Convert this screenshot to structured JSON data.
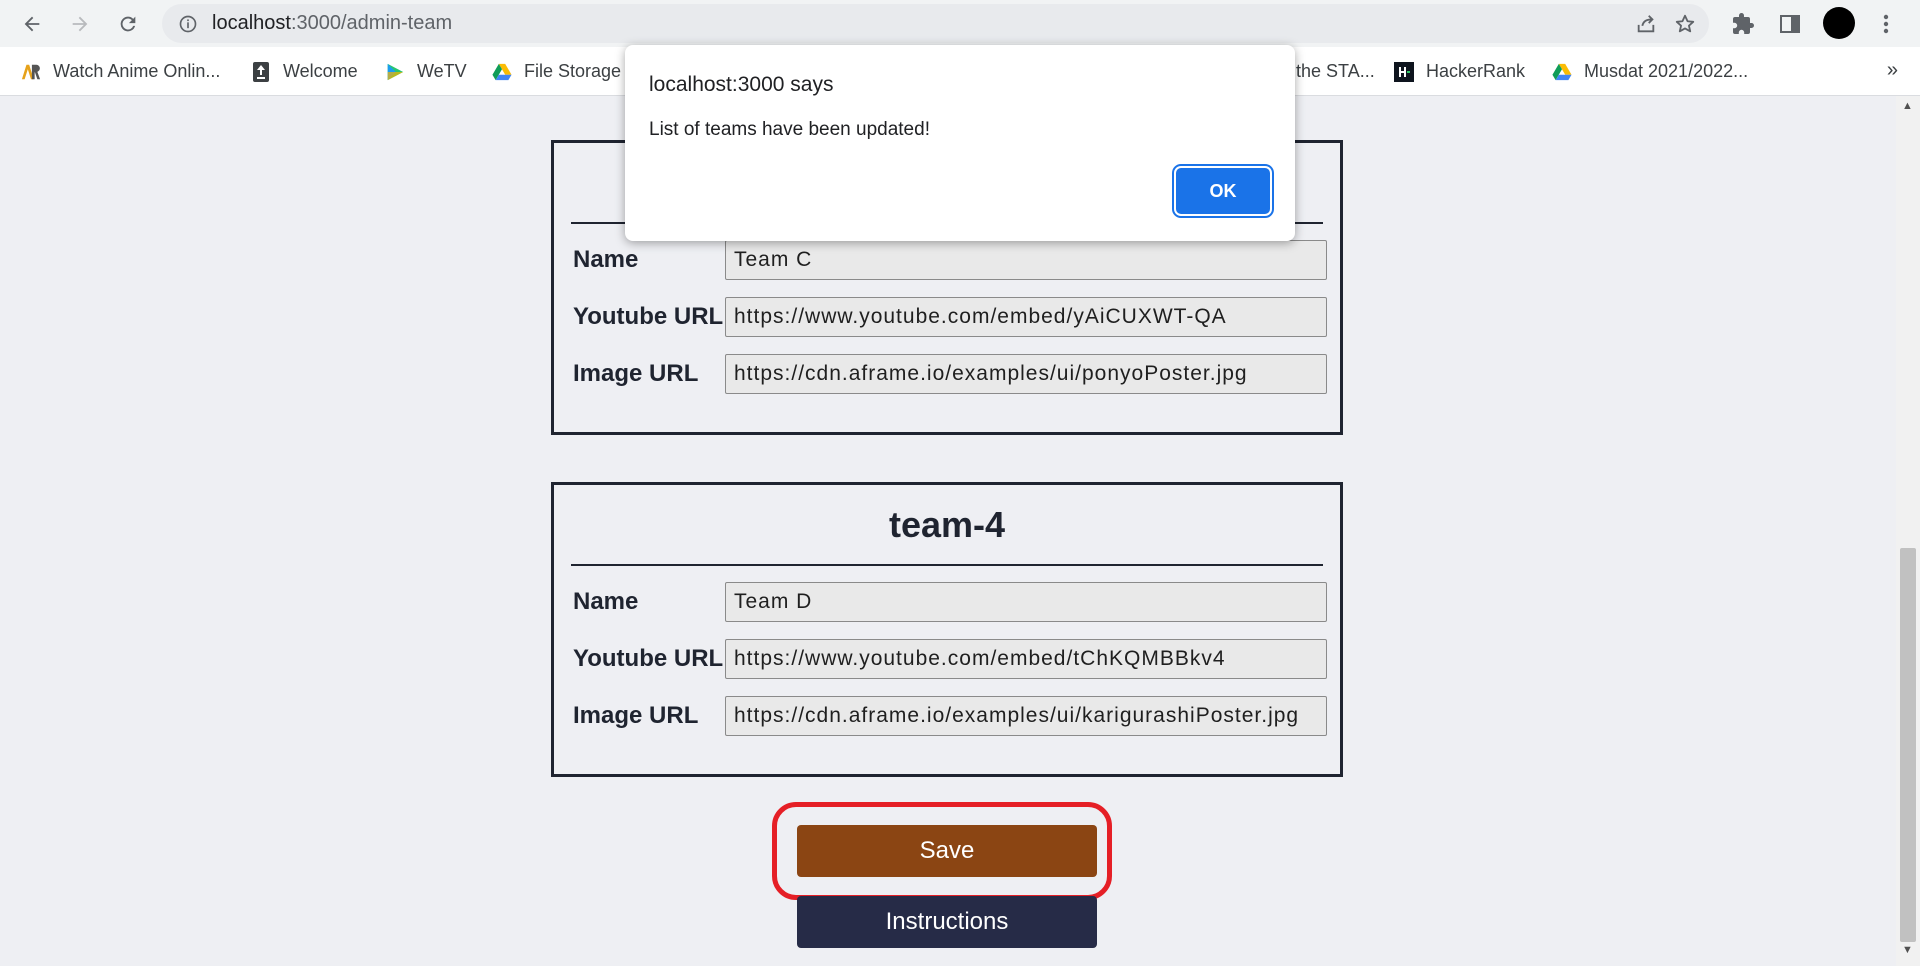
{
  "browser": {
    "url_host": "localhost",
    "url_path": ":3000/admin-team",
    "bookmarks": [
      {
        "label": "Watch Anime Onlin...",
        "icon": "ar-logo-icon"
      },
      {
        "label": "Welcome",
        "icon": "upload-page-icon"
      },
      {
        "label": "WeTV",
        "icon": "wetv-play-icon"
      },
      {
        "label": "File Storage",
        "icon": "google-drive-icon"
      },
      {
        "label": "the STA...",
        "icon": "bookmark-icon"
      },
      {
        "label": "HackerRank",
        "icon": "hackerrank-icon"
      },
      {
        "label": "Musdat 2021/2022...",
        "icon": "google-drive-icon"
      }
    ],
    "more_bookmarks": "»"
  },
  "teams": [
    {
      "name_label": "Name",
      "youtube_label": "Youtube URL",
      "image_label": "Image URL",
      "name": "Team C",
      "youtube": "https://www.youtube.com/embed/yAiCUXWT-QA",
      "image": "https://cdn.aframe.io/examples/ui/ponyoPoster.jpg"
    },
    {
      "title": "team-4",
      "name_label": "Name",
      "youtube_label": "Youtube URL",
      "image_label": "Image URL",
      "name": "Team D",
      "youtube": "https://www.youtube.com/embed/tChKQMBBkv4",
      "image": "https://cdn.aframe.io/examples/ui/karigurashiPoster.jpg"
    }
  ],
  "buttons": {
    "save": "Save",
    "instructions": "Instructions"
  },
  "dialog": {
    "title": "localhost:3000 says",
    "message": "List of teams have been updated!",
    "ok": "OK"
  },
  "colors": {
    "save": "#8b4513",
    "instructions": "#262b47",
    "highlight": "#e51f26",
    "dialog_ok": "#1a73e8"
  }
}
